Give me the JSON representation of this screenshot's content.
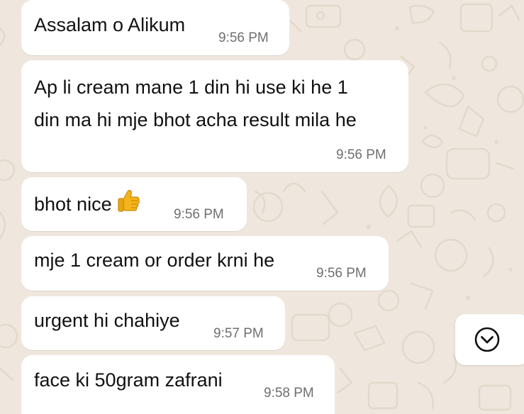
{
  "chat": {
    "messages": [
      {
        "text": "Assalam o Alikum",
        "time": "9:56 PM"
      },
      {
        "lines": [
          "Ap li cream mane 1 din hi use ki he 1",
          "din ma hi mje bhot acha result mila he"
        ],
        "time": "9:56 PM"
      },
      {
        "text": "bhot nice",
        "emoji": "thumbs-up-emoji",
        "time": "9:56 PM"
      },
      {
        "text": "mje 1 cream or order krni he",
        "time": "9:56 PM"
      },
      {
        "text": "urgent hi chahiye",
        "time": "9:57 PM"
      },
      {
        "text": "face ki 50gram zafrani",
        "time": "9:58 PM"
      }
    ]
  },
  "scroll_button": {
    "icon": "chevron-down-circle-icon"
  },
  "colors": {
    "background": "#efe7dd",
    "bubble": "#ffffff",
    "text": "#111111",
    "time": "#6f6f6f",
    "thumb": "#f4b41a"
  }
}
